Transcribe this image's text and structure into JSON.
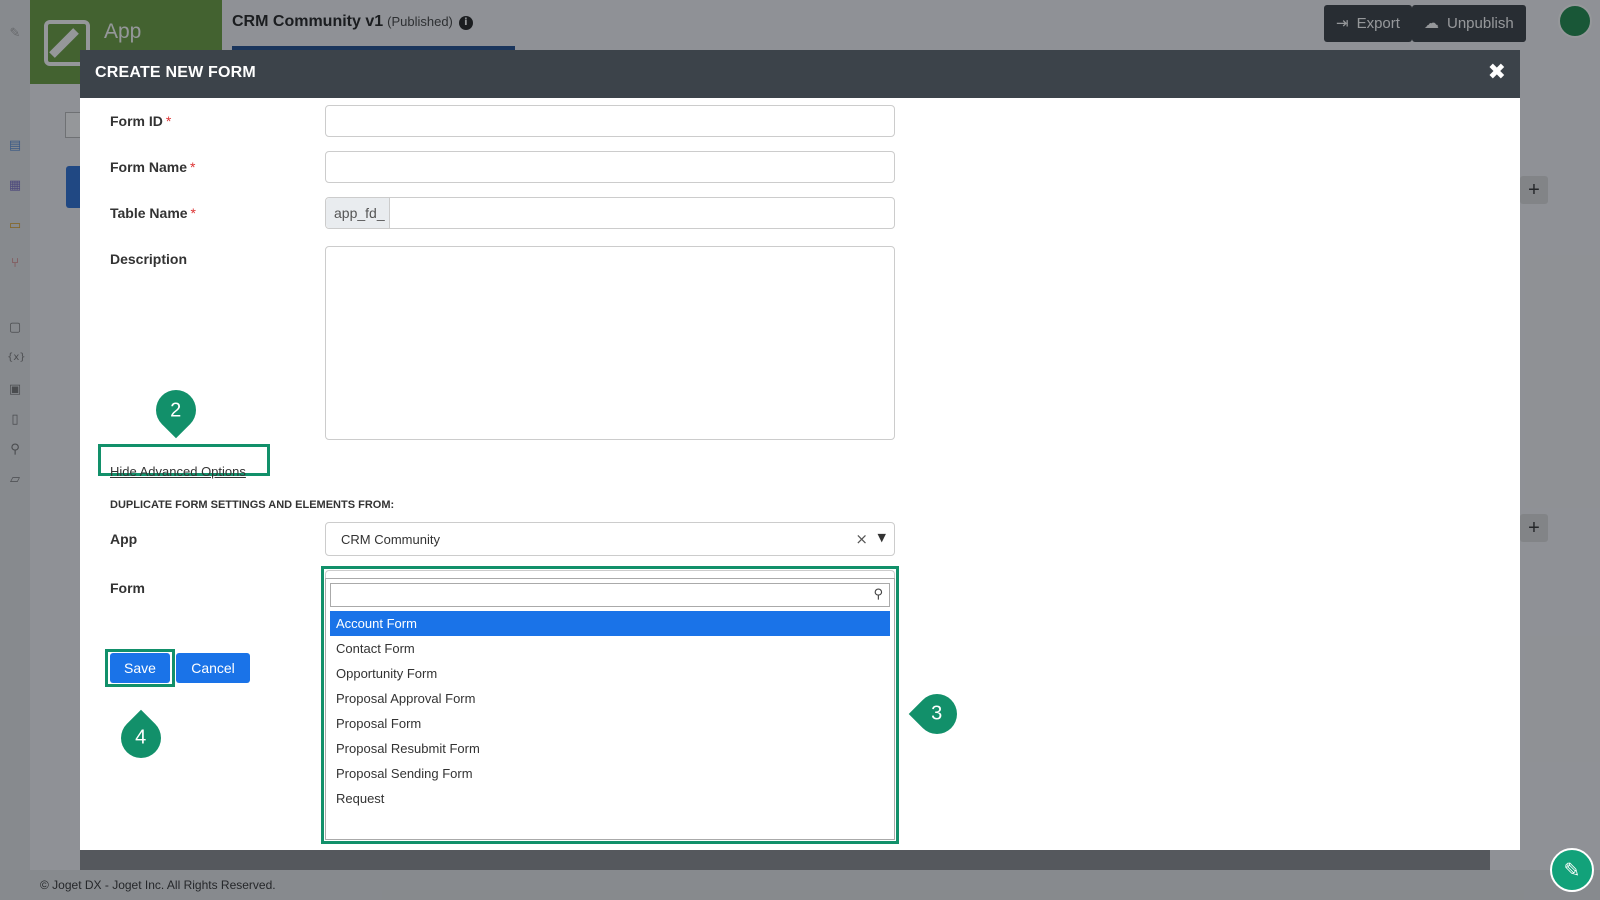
{
  "app": {
    "brand_label": "App",
    "title": "CRM Community v1",
    "status": "(Published)",
    "info_glyph": "i",
    "export_label": "Export",
    "unpublish_label": "Unpublish",
    "footer": "© Joget DX - Joget Inc. All Rights Reserved."
  },
  "modal": {
    "title": "CREATE NEW FORM",
    "close_glyph": "✖",
    "fields": {
      "form_id_label": "Form ID",
      "form_name_label": "Form Name",
      "table_name_label": "Table Name",
      "table_prefix": "app_fd_",
      "description_label": "Description",
      "required_mark": "*"
    },
    "advanced_link": "Hide Advanced Options",
    "duplicate_heading": "DUPLICATE FORM SETTINGS AND ELEMENTS FROM:",
    "app_label": "App",
    "app_selected": "CRM Community",
    "form_label": "Form",
    "form_selected": "",
    "form_options": [
      "Account Form",
      "Contact Form",
      "Opportunity Form",
      "Proposal Approval Form",
      "Proposal Form",
      "Proposal Resubmit Form",
      "Proposal Sending Form",
      "Request"
    ],
    "save_label": "Save",
    "cancel_label": "Cancel"
  },
  "annotations": {
    "marker_2": "2",
    "marker_3": "3",
    "marker_4": "4"
  },
  "colors": {
    "accent": "#1a73e8",
    "highlight": "#12906a",
    "header": "#3c434a",
    "brand": "#6a9e3f"
  },
  "icons": {
    "export": "export-icon",
    "unpublish": "cloud-upload-icon",
    "close": "close-icon",
    "search": "search-icon",
    "edit": "pencil-icon"
  }
}
